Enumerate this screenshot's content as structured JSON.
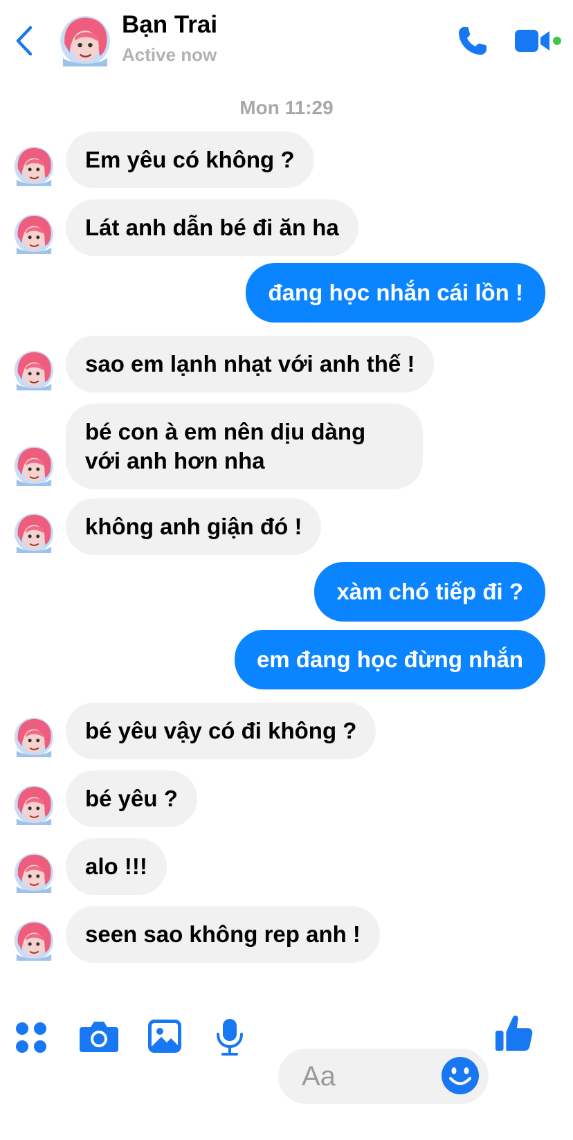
{
  "header": {
    "contact_name": "Bạn Trai",
    "status": "Active now",
    "icons": [
      "back-chevron-icon",
      "avatar",
      "phone-call-icon",
      "video-call-icon"
    ],
    "accent_color": "#1877f2",
    "online_dot_color": "#44c54a"
  },
  "thread": {
    "timestamp": "Mon 11:29",
    "messages": [
      {
        "sender": "them",
        "text": "Em yêu có không ?"
      },
      {
        "sender": "them",
        "text": "Lát anh dẫn bé đi ăn ha"
      },
      {
        "sender": "me",
        "text": "đang học nhắn cái lồn !"
      },
      {
        "sender": "them",
        "text": "sao em lạnh nhạt với anh thế !"
      },
      {
        "sender": "them",
        "text": "bé con à em nên dịu dàng với anh hơn nha"
      },
      {
        "sender": "them",
        "text": "không anh giận đó !"
      },
      {
        "sender": "me",
        "text": "xàm chó tiếp đi ?"
      },
      {
        "sender": "me",
        "text": "em đang học đừng nhắn"
      },
      {
        "sender": "them",
        "text": "bé yêu vậy có đi không ?"
      },
      {
        "sender": "them",
        "text": "bé yêu ?"
      },
      {
        "sender": "them",
        "text": "alo !!!"
      },
      {
        "sender": "them",
        "text": "seen sao không rep anh !"
      }
    ],
    "outgoing_bubble_color": "#0a84ff",
    "incoming_bubble_color": "#f1f1f1"
  },
  "composer": {
    "placeholder": "Aa",
    "icons": [
      "apps-grid-icon",
      "camera-icon",
      "image-gallery-icon",
      "microphone-icon",
      "emoji-icon",
      "thumbs-up-icon"
    ]
  }
}
